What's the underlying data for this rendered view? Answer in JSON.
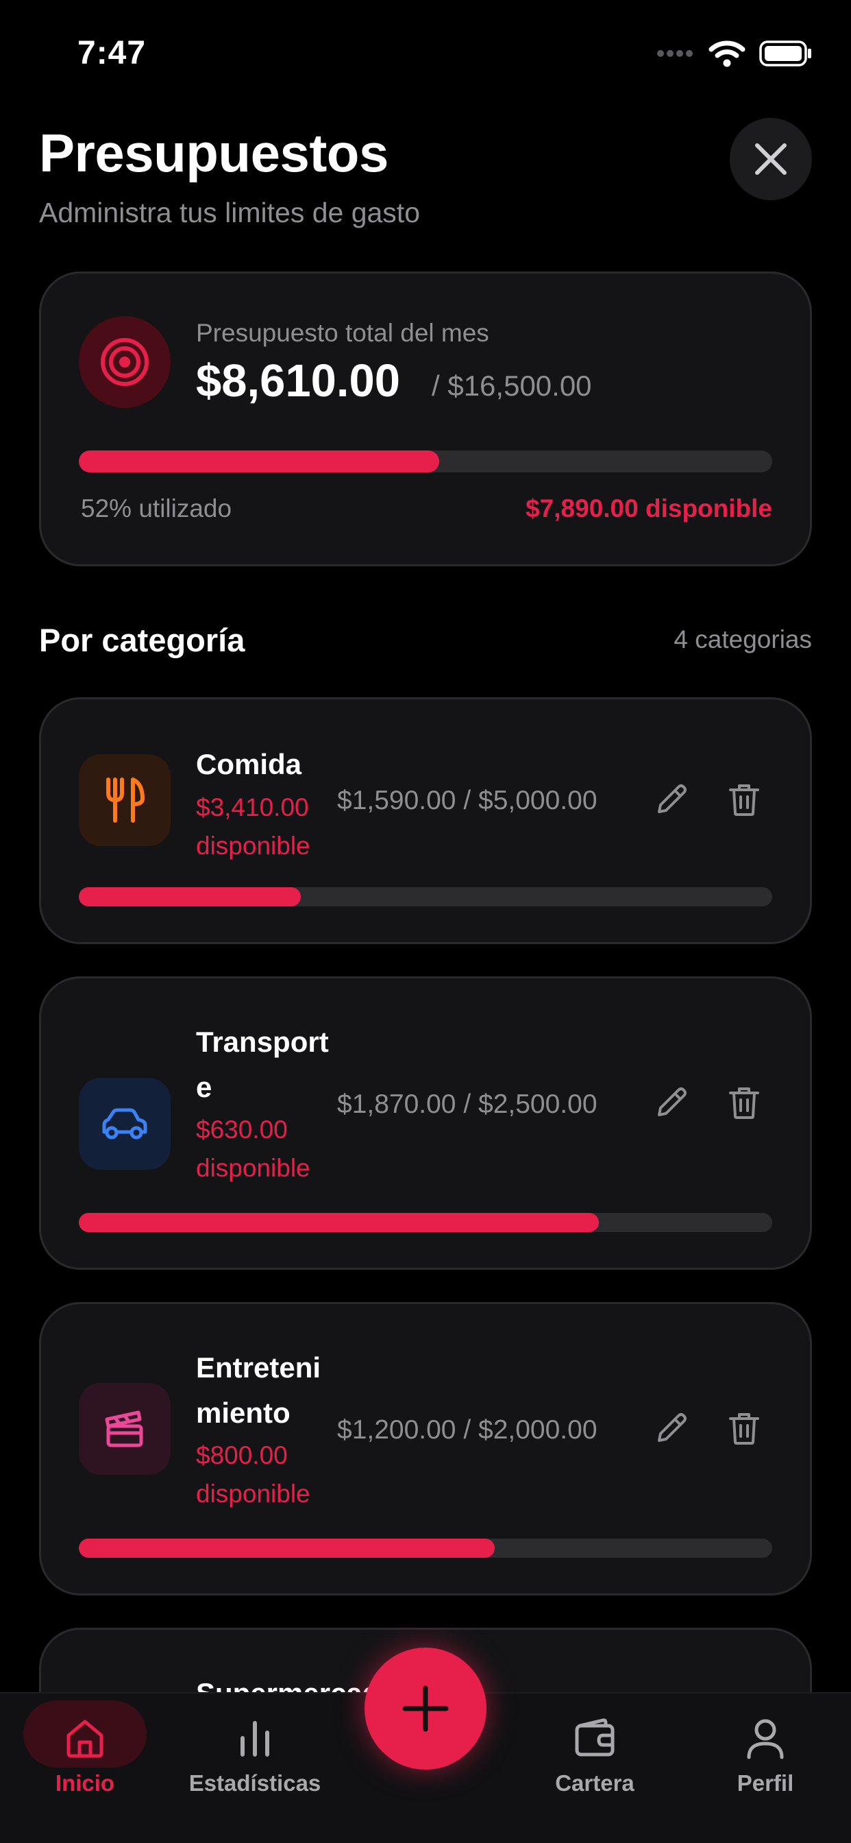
{
  "status_bar": {
    "time": "7:47"
  },
  "header": {
    "title": "Presupuestos",
    "subtitle": "Administra tus limites de gasto"
  },
  "summary": {
    "label": "Presupuesto total del mes",
    "spent": "$8,610.00",
    "total": "/ $16,500.00",
    "progress": 0.52,
    "used_text": "52% utilizado",
    "available_text": "$7,890.00 disponible"
  },
  "section": {
    "title": "Por categoría",
    "count": "4 categorias"
  },
  "categories": [
    {
      "name": "Comida",
      "available": "$3,410.00 disponible",
      "amounts": "$1,590.00 / $5,000.00",
      "progress": 0.32,
      "icon": "fork-knife-icon",
      "icon_color": "#ff7a1a",
      "icon_bg": "#2e1a0f"
    },
    {
      "name": "Transporte",
      "available": "$630.00 disponible",
      "amounts": "$1,870.00 / $2,500.00",
      "progress": 0.75,
      "icon": "car-icon",
      "icon_color": "#3b82f6",
      "icon_bg": "#12203a"
    },
    {
      "name": "Entretenimiento",
      "available": "$800.00 disponible",
      "amounts": "$1,200.00 / $2,000.00",
      "progress": 0.6,
      "icon": "clapperboard-icon",
      "icon_color": "#ec4899",
      "icon_bg": "#2e1420"
    },
    {
      "name": "Supermercado"
    }
  ],
  "nav": {
    "home": "Inicio",
    "stats": "Estadísticas",
    "wallet": "Cartera",
    "profile": "Perfil"
  },
  "colors": {
    "accent": "#e6204b",
    "background": "#000000",
    "card": "#141416"
  }
}
